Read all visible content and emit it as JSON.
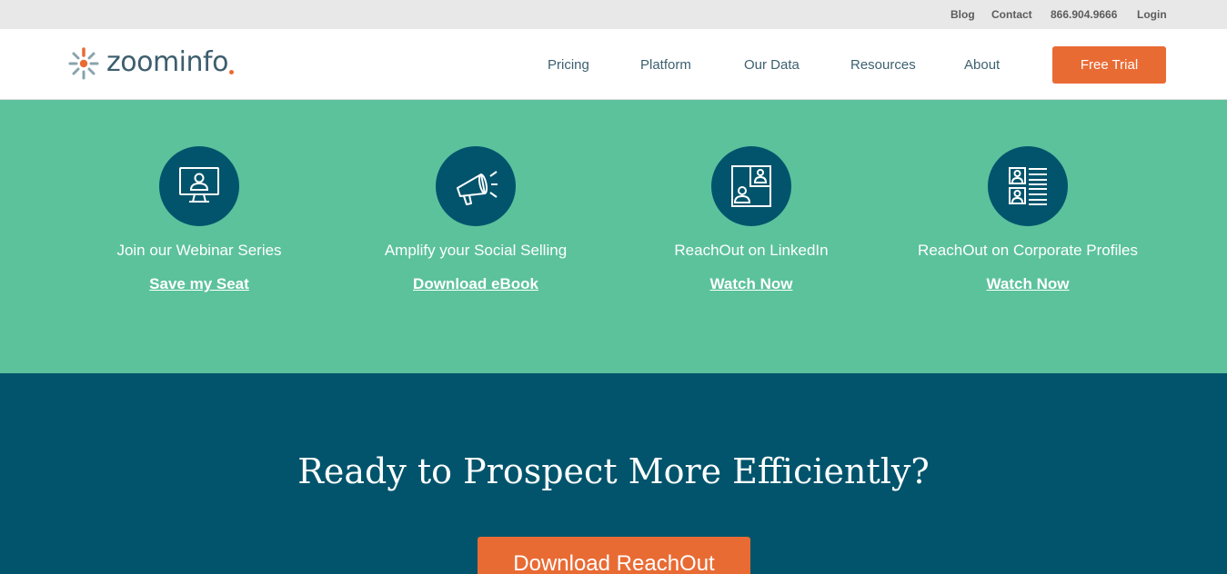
{
  "utility_nav": {
    "blog": "Blog",
    "contact": "Contact",
    "phone": "866.904.9666",
    "login": "Login"
  },
  "header": {
    "logo_text": "zoominfo",
    "nav": [
      "Pricing",
      "Platform",
      "Our Data",
      "Resources",
      "About"
    ],
    "cta": "Free Trial"
  },
  "features": [
    {
      "icon": "webinar-monitor-icon",
      "title": "Join our Webinar Series",
      "cta": "Save my Seat"
    },
    {
      "icon": "megaphone-icon",
      "title": "Amplify your Social Selling",
      "cta": "Download eBook"
    },
    {
      "icon": "linkedin-profile-icon",
      "title": "ReachOut on LinkedIn",
      "cta": "Watch Now"
    },
    {
      "icon": "corporate-profiles-icon",
      "title": "ReachOut on Corporate Profiles",
      "cta": "Watch Now"
    }
  ],
  "cta_band": {
    "heading": "Ready to Prospect More Efficiently?",
    "button": "Download ReachOut"
  },
  "colors": {
    "accent_orange": "#e96b34",
    "teal_green": "#5bc29c",
    "dark_teal": "#01546c",
    "utility_gray": "#e8e8e8"
  }
}
